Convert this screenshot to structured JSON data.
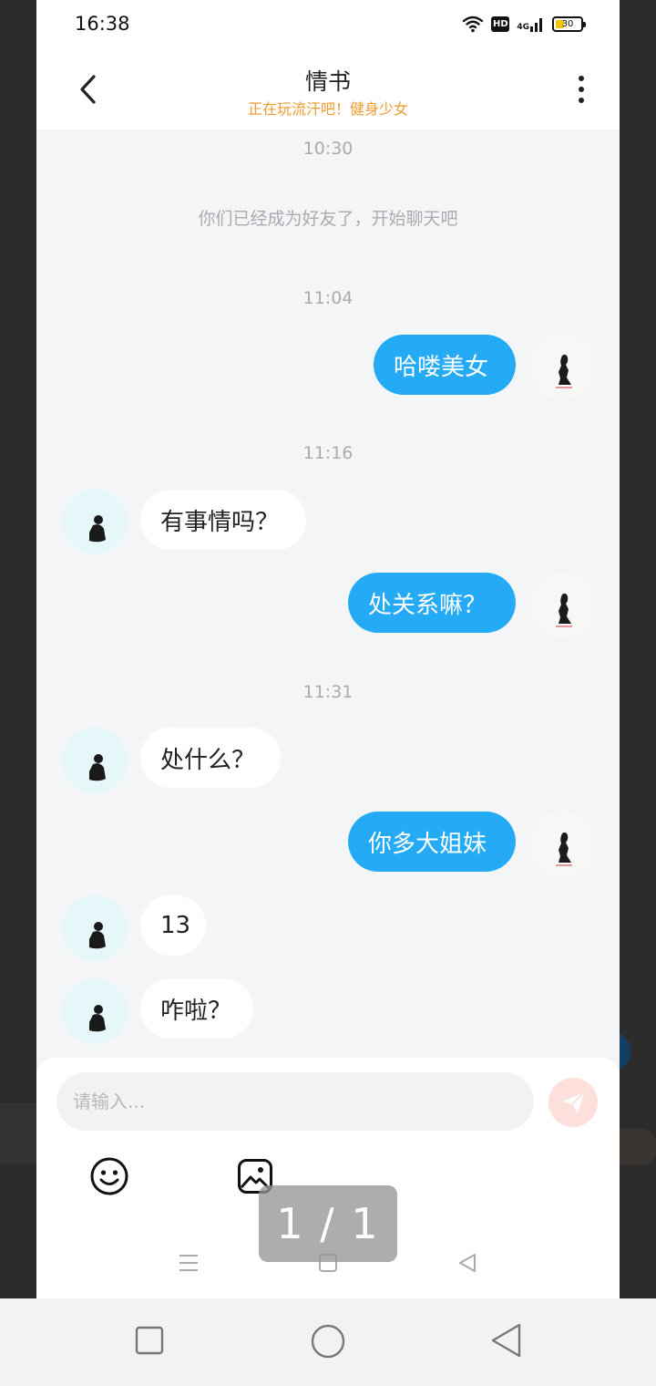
{
  "status_bar": {
    "time": "16:38",
    "hd": "HD",
    "network": "4G",
    "battery": "30"
  },
  "header": {
    "title": "情书",
    "subtitle": "正在玩流汗吧！健身少女"
  },
  "chat": {
    "timestamp_1": "10:30",
    "system_notice": "你们已经成为好友了，开始聊天吧",
    "timestamp_2": "11:04",
    "msg_1": "哈喽美女",
    "timestamp_3": "11:16",
    "msg_2": "有事情吗？",
    "msg_3": "处关系嘛？",
    "timestamp_4": "11:31",
    "msg_4": "处什么？",
    "msg_5": "你多大姐妹",
    "msg_6": "13",
    "msg_7": "咋啦？"
  },
  "input": {
    "placeholder": "请输入..."
  },
  "page_indicator": "1 / 1",
  "colors": {
    "accent_blue": "#25aaf5",
    "subtitle_orange": "#ee9a2e"
  }
}
